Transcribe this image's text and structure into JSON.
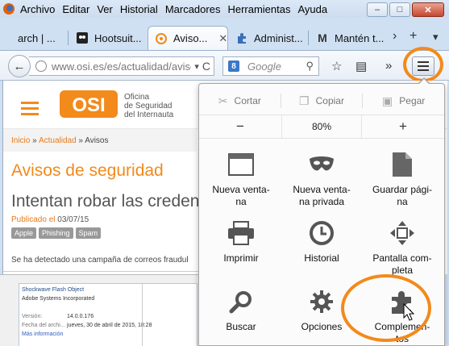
{
  "menubar": {
    "items": [
      "Archivo",
      "Editar",
      "Ver",
      "Historial",
      "Marcadores",
      "Herramientas",
      "Ayuda"
    ],
    "minimize": "–",
    "maximize": "□",
    "close": "✕"
  },
  "tabs": [
    {
      "title": "arch | ..."
    },
    {
      "title": "Hootsuit..."
    },
    {
      "title": "Aviso...",
      "close": "✕"
    },
    {
      "title": "Administ..."
    },
    {
      "title": "Mantén t..."
    }
  ],
  "tab_controls": {
    "overflow": "›",
    "new_tab": "+",
    "dropdown": "▾"
  },
  "navbar": {
    "back": "←",
    "url": "www.osi.es/es/actualidad/avisc",
    "url_dropdown": "▾",
    "reload": "C",
    "search_engine_badge": "8",
    "search_placeholder": "Google",
    "search_icon": "⚲",
    "bookmark": "☆",
    "reading_list": "▤",
    "more": "»"
  },
  "page": {
    "logo_text": "OSI",
    "logo_subtitle": [
      "Oficina",
      "de Seguridad",
      "del Internauta"
    ],
    "breadcrumb": {
      "inicio": "Inicio",
      "sep": "»",
      "actualidad": "Actualidad",
      "current": "Avisos"
    },
    "section_title": "Avisos de seguridad",
    "article_title": "Intentan robar las credenciales",
    "published_label": "Publicado el",
    "published_date": "03/07/15",
    "tags": [
      "Apple",
      "Phishing",
      "Spam"
    ],
    "body_text": "Se ha detectado una campaña de correos fraudul"
  },
  "inserted_screenshot": {
    "title": "Shockwave Flash Object",
    "company": "Adobe Systems Incorporated",
    "version_label": "Versión:",
    "version_value": "14.0.0.176",
    "date_label": "Fecha del archi...",
    "date_value": "jueves, 30 de abril de 2015, 18:28",
    "more_link": "Más información"
  },
  "panel": {
    "cut": "Cortar",
    "copy": "Copiar",
    "paste": "Pegar",
    "zoom_out": "−",
    "zoom_level": "80%",
    "zoom_in": "+",
    "items": [
      {
        "line1": "Nueva venta-",
        "line2": "na"
      },
      {
        "line1": "Nueva venta-",
        "line2": "na privada"
      },
      {
        "line1": "Guardar pági-",
        "line2": "na"
      },
      {
        "line1": "Imprimir",
        "line2": ""
      },
      {
        "line1": "Historial",
        "line2": ""
      },
      {
        "line1": "Pantalla com-",
        "line2": "pleta"
      },
      {
        "line1": "Buscar",
        "line2": ""
      },
      {
        "line1": "Opciones",
        "line2": ""
      },
      {
        "line1": "Complemen-",
        "line2": "tos"
      }
    ]
  },
  "colors": {
    "accent_orange": "#f28a1c",
    "osi_orange": "#e87a1a",
    "tab_active": "#f2f6fb"
  }
}
